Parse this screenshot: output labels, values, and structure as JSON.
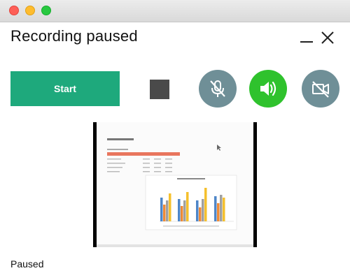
{
  "window": {
    "title": "Recording paused"
  },
  "controls": {
    "start_label": "Start"
  },
  "status": {
    "text": "Paused"
  },
  "colors": {
    "start": "#1ea97c",
    "stop": "#4a4a4a",
    "mic_muted": "#6f8f97",
    "speaker_on": "#2fc22d",
    "camera_off": "#6f8f97"
  },
  "icons": {
    "minimize": "minimize-icon",
    "close": "close-icon",
    "mic": "microphone-muted-icon",
    "speaker": "speaker-on-icon",
    "camera": "camera-off-icon"
  }
}
